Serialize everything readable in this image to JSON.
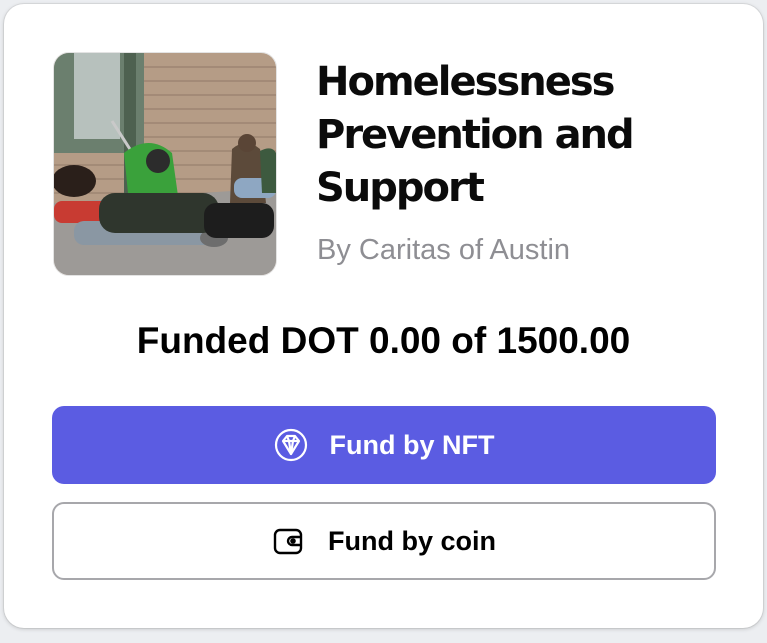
{
  "campaign": {
    "title": "Homelessness Prevention and Support",
    "organization": "By Caritas of Austin",
    "funding_text": "Funded DOT 0.00 of 1500.00",
    "image_icon": "campaign-photo"
  },
  "actions": {
    "fund_nft": {
      "label": "Fund by NFT",
      "icon": "diamond-icon"
    },
    "fund_coin": {
      "label": "Fund by coin",
      "icon": "wallet-icon"
    }
  },
  "colors": {
    "primary": "#5b5ce2",
    "title": "#0b0b0b",
    "muted": "#8e8e93",
    "outline": "#a7a7ab"
  }
}
